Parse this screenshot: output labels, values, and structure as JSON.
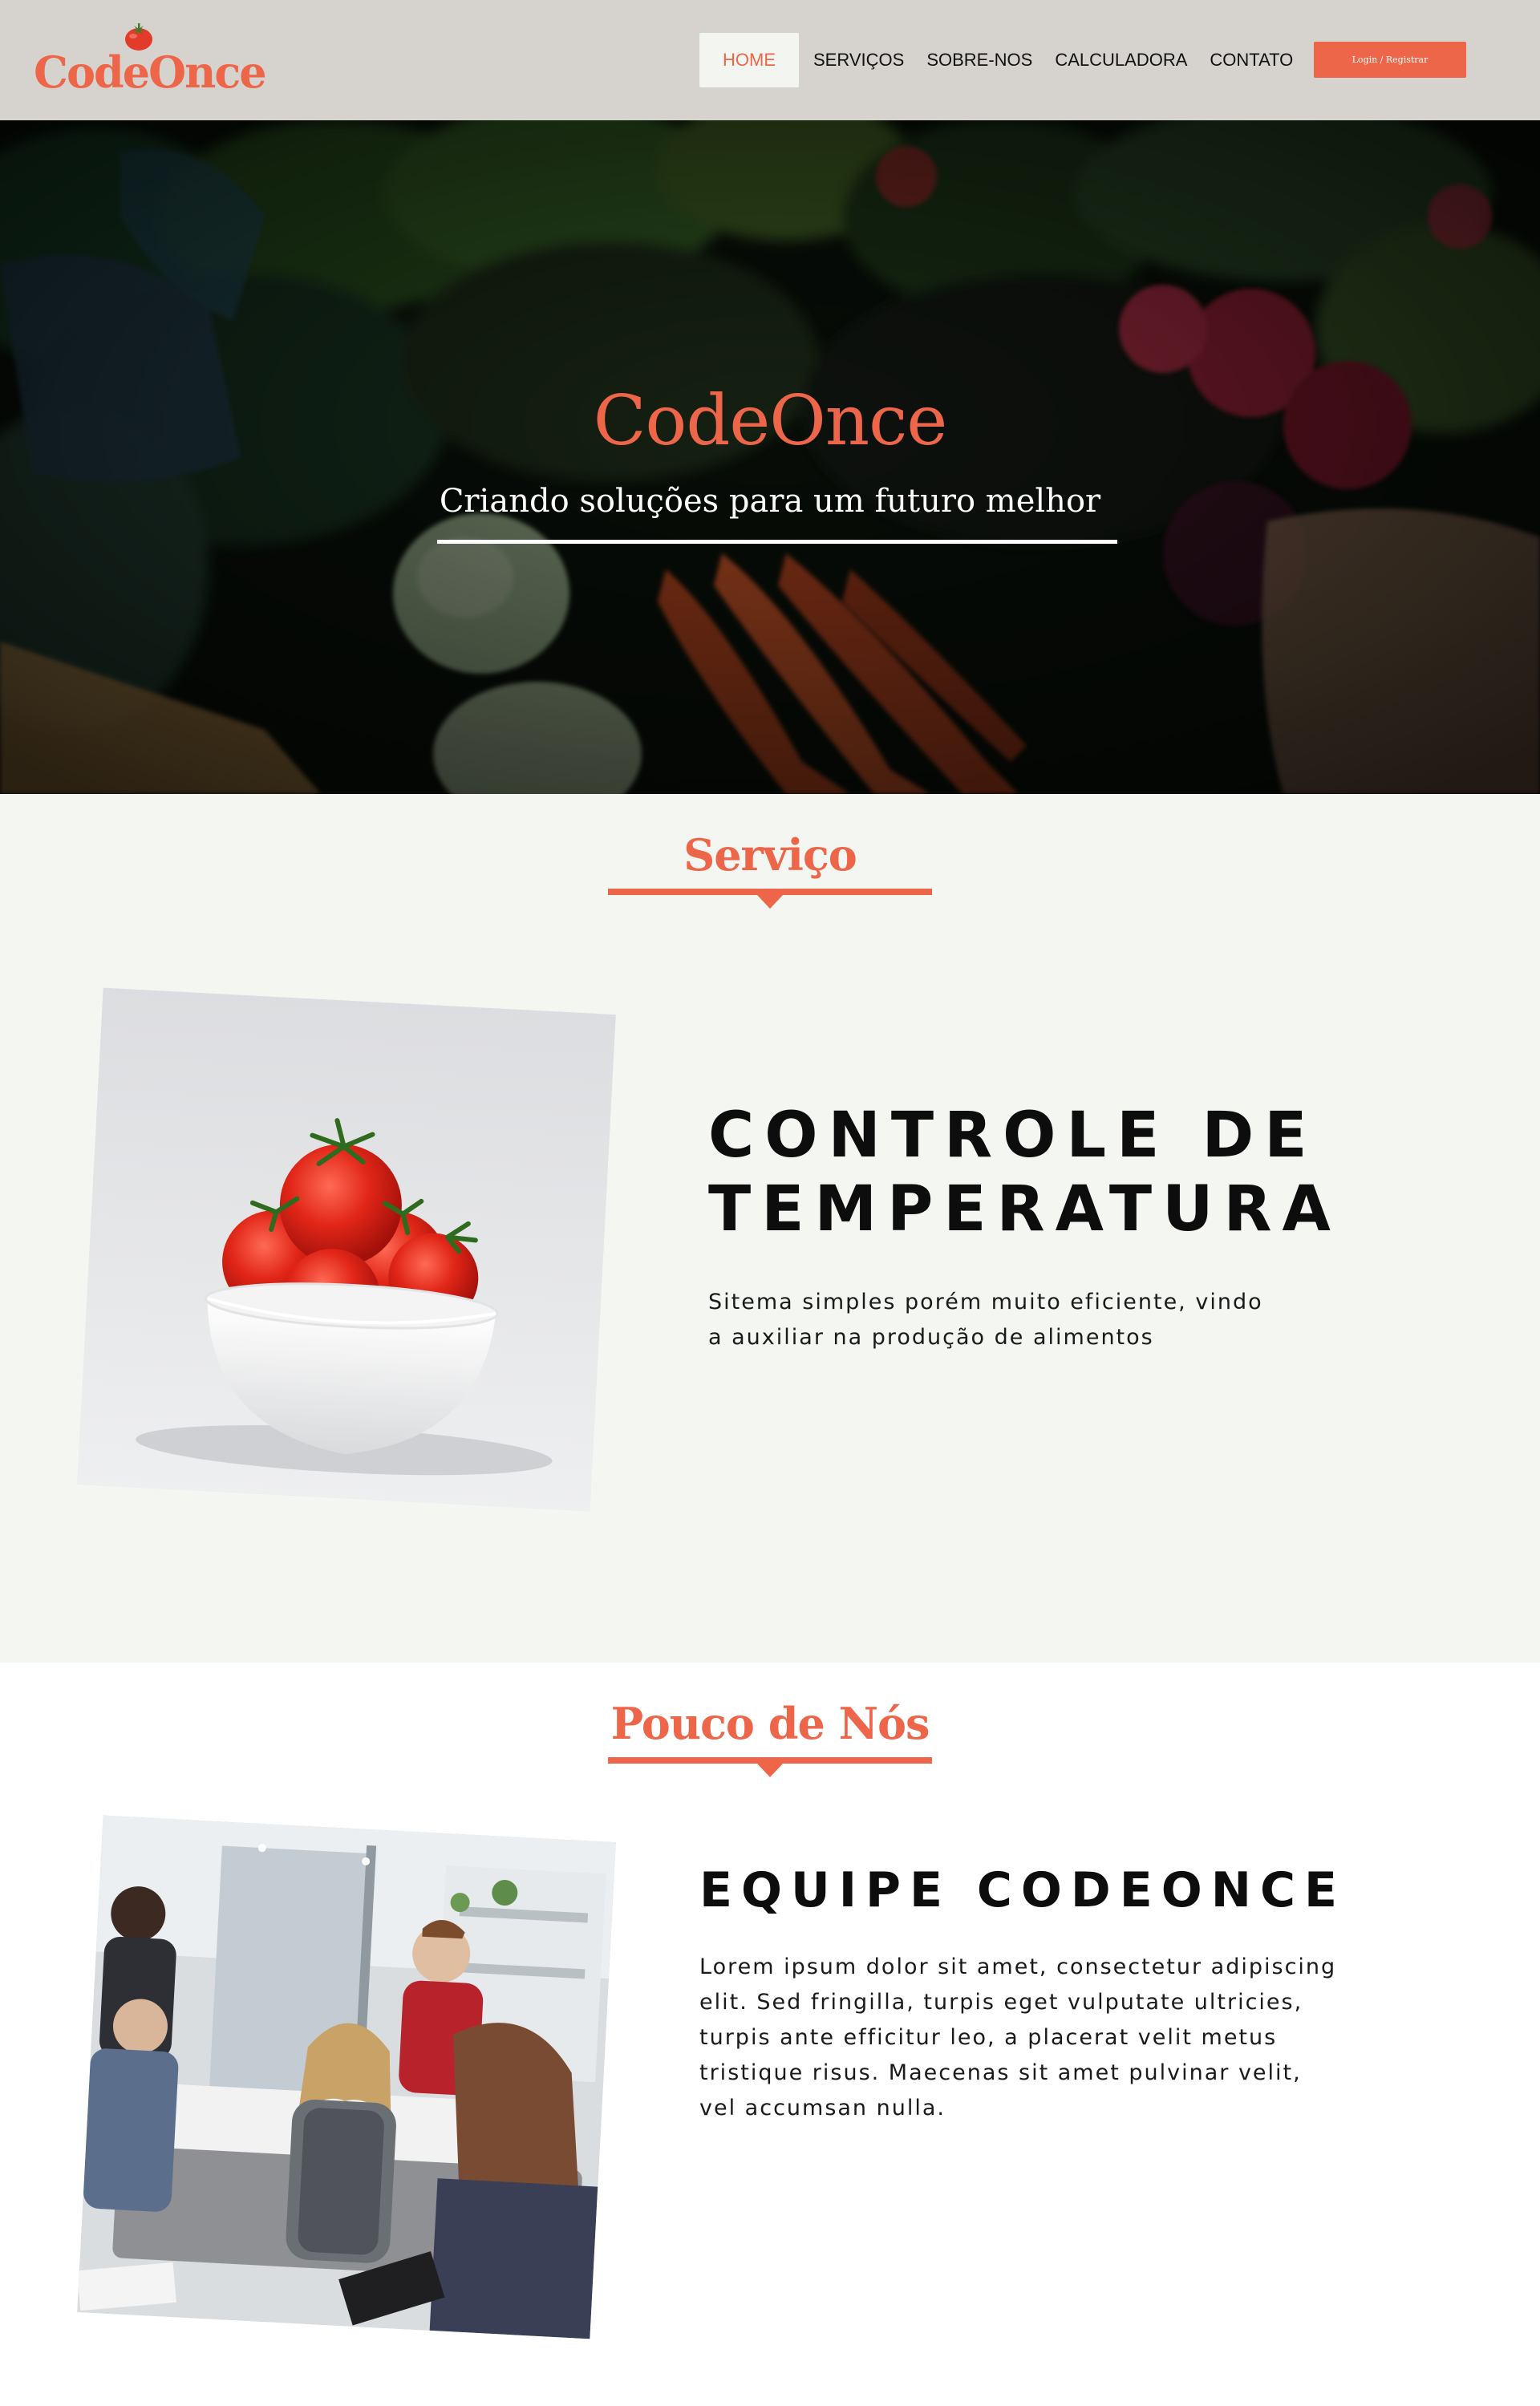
{
  "navbar": {
    "logo": "CodeOnce",
    "items": [
      {
        "label": "HOME",
        "active": true
      },
      {
        "label": "SERVIÇOS",
        "active": false
      },
      {
        "label": "SOBRE-NOS",
        "active": false
      },
      {
        "label": "CALCULADORA",
        "active": false
      },
      {
        "label": "CONTATO",
        "active": false
      }
    ],
    "login_label": "Login /  Registrar"
  },
  "hero": {
    "title": "CodeOnce",
    "subtitle": "Criando soluções para um futuro melhor"
  },
  "service": {
    "heading": "Serviço",
    "title_line1": "CONTROLE DE",
    "title_line2": "TEMPERATURA",
    "description": "Sitema simples porém muito eficiente, vindo a auxiliar na produção de alimentos"
  },
  "about": {
    "heading": "Pouco de Nós",
    "title": "EQUIPE CODEONCE",
    "description": "Lorem ipsum dolor sit amet, consectetur adipiscing elit. Sed fringilla, turpis eget vulputate ultricies, turpis ante efficitur leo, a placerat velit metus tristique risus. Maecenas sit amet pulvinar velit, vel accumsan nulla."
  },
  "colors": {
    "accent": "#ee6649",
    "navbar_bg": "#d6d3cf",
    "service_bg": "#f3f6f1",
    "text_dark": "#0d0d0d"
  },
  "icons": {
    "logo_mark": "tomato-icon"
  }
}
